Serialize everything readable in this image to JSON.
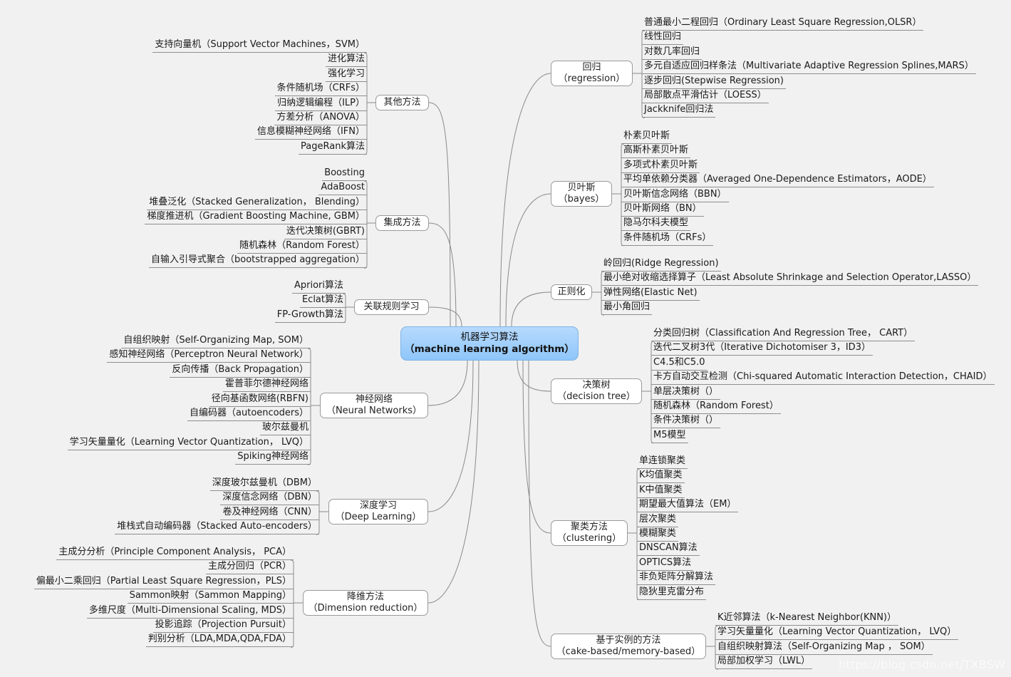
{
  "root": {
    "title_cn": "机器学习算法",
    "title_en": "（machine learning algorithm）"
  },
  "branches": [
    {
      "id": "other-methods",
      "side": "left",
      "label_cn": "其他方法",
      "label_en": "",
      "leaves": [
        "支持向量机（Support Vector Machines，SVM）",
        "进化算法",
        "强化学习",
        "条件随机场（CRFs）",
        "归纳逻辑编程（ILP）",
        "方差分析（ANOVA）",
        "信息模糊神经网络（IFN）",
        "PageRank算法"
      ]
    },
    {
      "id": "ensemble-methods",
      "side": "left",
      "label_cn": "集成方法",
      "label_en": "",
      "leaves": [
        "Boosting",
        "AdaBoost",
        "堆叠泛化（Stacked Generalization， Blending）",
        "梯度推进机（Gradient Boosting Machine, GBM）",
        "迭代决策树(GBRT)",
        "随机森林（Random Forest）",
        "自输入引导式聚合（bootstrapped aggregation）"
      ]
    },
    {
      "id": "association-rule-learning",
      "side": "left",
      "label_cn": "关联规则学习",
      "label_en": "",
      "leaves": [
        "Apriori算法",
        "Eclat算法",
        "FP-Growth算法"
      ]
    },
    {
      "id": "neural-networks",
      "side": "left",
      "label_cn": "神经网络",
      "label_en": "（Neural Networks）",
      "leaves": [
        "自组织映射（Self-Organizing Map, SOM）",
        "感知神经网络（Perceptron Neural Network）",
        "反向传播（Back Propagation）",
        "霍普菲尔德神经网络",
        "径向基函数网络(RBFN)",
        "自编码器（autoencoders）",
        "玻尔兹曼机",
        "学习矢量量化（Learning Vector Quantization， LVQ）",
        "Spiking神经网络"
      ]
    },
    {
      "id": "deep-learning",
      "side": "left",
      "label_cn": "深度学习",
      "label_en": "（Deep Learning）",
      "leaves": [
        "深度玻尔兹曼机（DBM）",
        "深度信念网络（DBN）",
        "卷及神经网络（CNN）",
        "堆栈式自动编码器（Stacked Auto-encoders）"
      ]
    },
    {
      "id": "dimension-reduction",
      "side": "left",
      "label_cn": "降维方法",
      "label_en": "（Dimension reduction）",
      "leaves": [
        "主成分分析（Principle Component Analysis， PCA）",
        "主成分回归（PCR）",
        "偏最小二乘回归（Partial Least Square Regression，PLS）",
        "Sammon映射（Sammon Mapping）",
        "多维尺度（Multi-Dimensional Scaling, MDS）",
        "投影追踪（Projection Pursuit）",
        "判别分析（LDA,MDA,QDA,FDA）"
      ]
    },
    {
      "id": "regression",
      "side": "right",
      "label_cn": "回归",
      "label_en": "（regression）",
      "leaves": [
        "普通最小二程回归（Ordinary Least Square Regression,OLSR）",
        "线性回归",
        "对数几率回归",
        "多元自适应回归样条法（Multivariate Adaptive Regression Splines,MARS）",
        "逐步回归(Stepwise Regression)",
        "局部散点平滑估计（LOESS）",
        "Jackknife回归法"
      ]
    },
    {
      "id": "bayes",
      "side": "right",
      "label_cn": "贝叶斯",
      "label_en": "（bayes）",
      "leaves": [
        "朴素贝叶斯",
        "高斯朴素贝叶斯",
        "多项式朴素贝叶斯",
        "平均单依赖分类器（Averaged One-Dependence Estimators，AODE）",
        "贝叶斯信念网络（BBN）",
        "贝叶斯网络（BN）",
        "隐马尔科夫模型",
        "条件随机场（CRFs）"
      ]
    },
    {
      "id": "regularization",
      "side": "right",
      "label_cn": "正则化",
      "label_en": "",
      "leaves": [
        "岭回归(Ridge Regression)",
        "最小绝对收缩选择算子（Least Absolute Shrinkage and Selection Operator,LASSO）",
        "弹性网络(Elastic Net)",
        "最小角回归"
      ]
    },
    {
      "id": "decision-tree",
      "side": "right",
      "label_cn": "决策树",
      "label_en": "（decision tree）",
      "leaves": [
        "分类回归树（Classification And Regression Tree， CART）",
        "迭代二叉树3代（Iterative Dichotomiser 3，ID3）",
        "C4.5和C5.0",
        "卡方自动交互检测（Chi-squared Automatic Interaction Detection，CHAID）",
        "单层决策树（）",
        "随机森林（Random Forest）",
        "条件决策树（）",
        "M5模型"
      ]
    },
    {
      "id": "clustering",
      "side": "right",
      "label_cn": "聚类方法",
      "label_en": "（clustering）",
      "leaves": [
        "单连锁聚类",
        "K均值聚类",
        "K中值聚类",
        "期望最大值算法（EM）",
        "层次聚类",
        "模糊聚类",
        "DNSCAN算法",
        "OPTICS算法",
        "非负矩阵分解算法",
        "隐狄里克雷分布"
      ]
    },
    {
      "id": "instance-based",
      "side": "right",
      "label_cn": "基于实例的方法",
      "label_en": "（cake-based/memory-based）",
      "leaves": [
        "K近邻算法（k-Nearest Neighbor(KNN)）",
        "学习矢量量化（Learning Vector Quantization， LVQ）",
        "自组织映射算法（Self-Organizing Map ， SOM）",
        "局部加权学习（LWL）"
      ]
    }
  ],
  "watermark": "https://blog.csdn.net/TXBSW",
  "colors": {
    "background": "#f1f1f1",
    "root_fill_top": "#b7dafd",
    "root_fill_bottom": "#8ec6fa",
    "root_border": "#7fb3e6",
    "branch_fill": "#ffffff",
    "branch_border": "#9a9a9a",
    "connector": "#8a8a8a"
  }
}
